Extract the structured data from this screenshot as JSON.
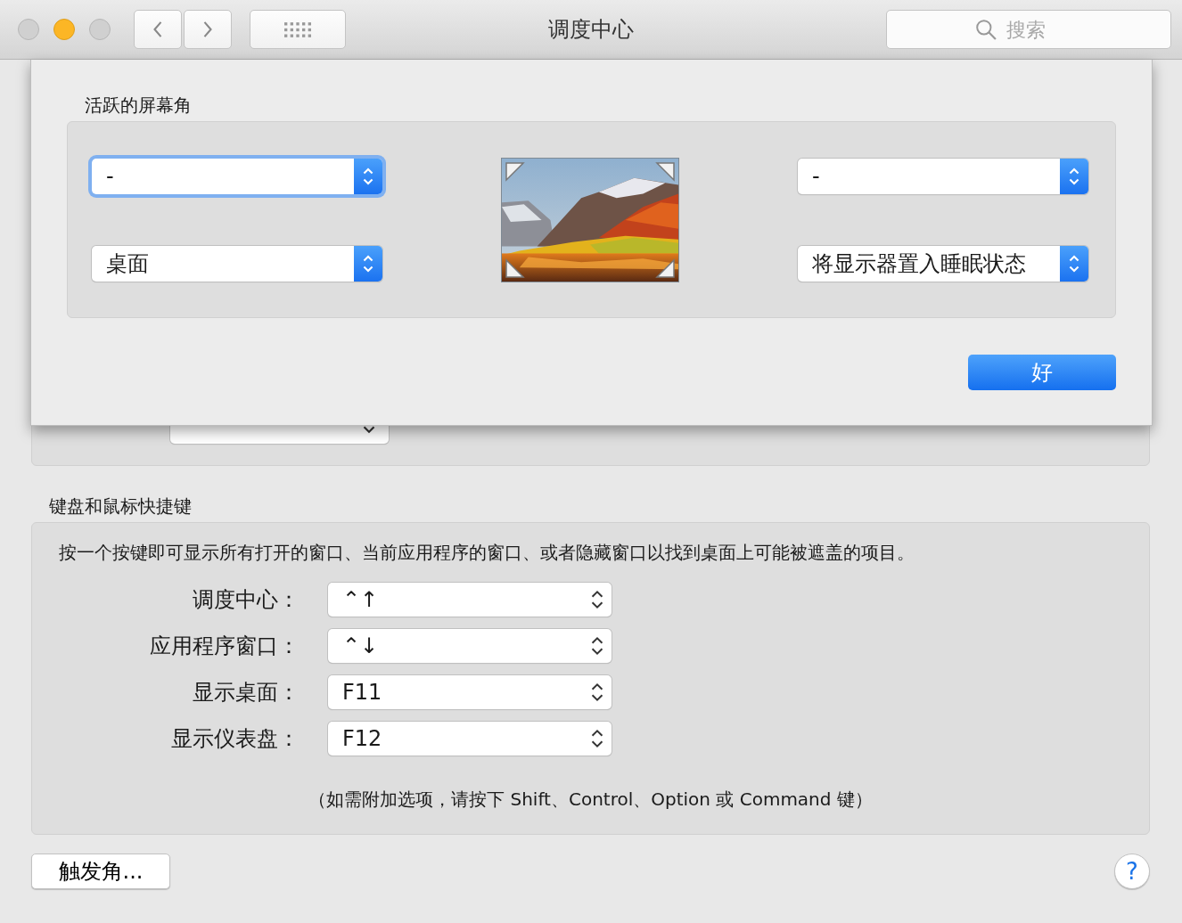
{
  "window": {
    "title": "调度中心",
    "search": {
      "placeholder": "搜索"
    }
  },
  "background": {
    "shortcuts": {
      "title": "键盘和鼠标快捷键",
      "description": "按一个按键即可显示所有打开的窗口、当前应用程序的窗口、或者隐藏窗口以找到桌面上可能被遮盖的项目。",
      "rows": [
        {
          "label": "调度中心：",
          "value": "⌃↑"
        },
        {
          "label": "应用程序窗口：",
          "value": "⌃↓"
        },
        {
          "label": "显示桌面：",
          "value": "F11"
        },
        {
          "label": "显示仪表盘：",
          "value": "F12"
        }
      ],
      "note": "（如需附加选项，请按下 Shift、Control、Option 或 Command 键）"
    },
    "hot_corners_button": "触发角...",
    "help": "?"
  },
  "sheet": {
    "title": "活跃的屏幕角",
    "corners": [
      {
        "value": "-",
        "focused": true
      },
      {
        "value": "桌面",
        "focused": false
      },
      {
        "value": "-",
        "focused": false
      },
      {
        "value": "将显示器置入睡眠状态",
        "focused": false
      }
    ],
    "ok_button": "好"
  }
}
